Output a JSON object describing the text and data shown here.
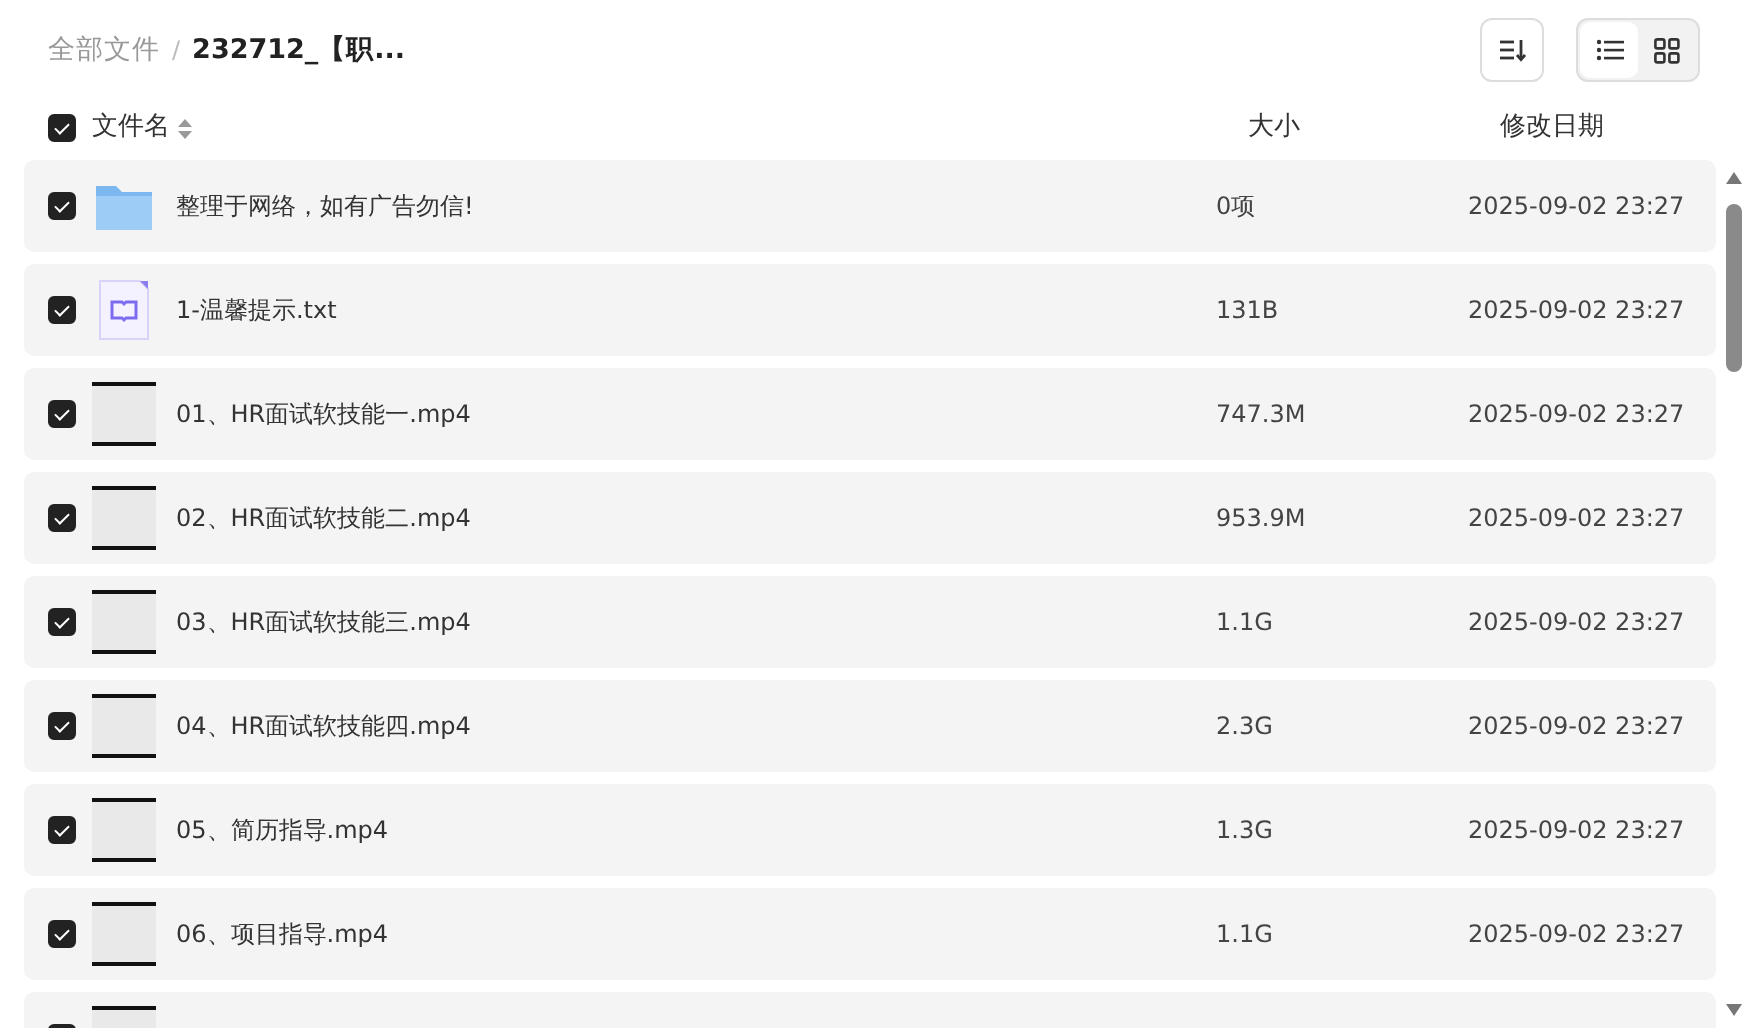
{
  "breadcrumb_separator": "/",
  "breadcrumb": [
    {
      "label": "全部文件",
      "current": false
    },
    {
      "label": "232712_【职...",
      "current": true
    }
  ],
  "view_toggle": [
    {
      "kind": "list",
      "selected": true
    },
    {
      "kind": "grid",
      "selected": false
    }
  ],
  "header": {
    "checked": true,
    "columns": [
      "文件名",
      "大小",
      "修改日期"
    ]
  },
  "files": [
    {
      "kind": "folder",
      "checked": true,
      "name": "整理于网络，如有广告勿信!",
      "size": "0项",
      "date": "2025-09-02 23:27"
    },
    {
      "kind": "text",
      "checked": true,
      "name": "1-温馨提示.txt",
      "size": "131B",
      "date": "2025-09-02 23:27"
    },
    {
      "kind": "video",
      "checked": true,
      "name": "01、HR面试软技能一.mp4",
      "size": "747.3M",
      "date": "2025-09-02 23:27"
    },
    {
      "kind": "video",
      "checked": true,
      "name": "02、HR面试软技能二.mp4",
      "size": "953.9M",
      "date": "2025-09-02 23:27"
    },
    {
      "kind": "video",
      "checked": true,
      "name": "03、HR面试软技能三.mp4",
      "size": "1.1G",
      "date": "2025-09-02 23:27"
    },
    {
      "kind": "video",
      "checked": true,
      "name": "04、HR面试软技能四.mp4",
      "size": "2.3G",
      "date": "2025-09-02 23:27"
    },
    {
      "kind": "video",
      "checked": true,
      "name": "05、简历指导.mp4",
      "size": "1.3G",
      "date": "2025-09-02 23:27"
    },
    {
      "kind": "video",
      "checked": true,
      "name": "06、项目指导.mp4",
      "size": "1.1G",
      "date": "2025-09-02 23:27"
    },
    {
      "kind": "video",
      "checked": true
    }
  ]
}
